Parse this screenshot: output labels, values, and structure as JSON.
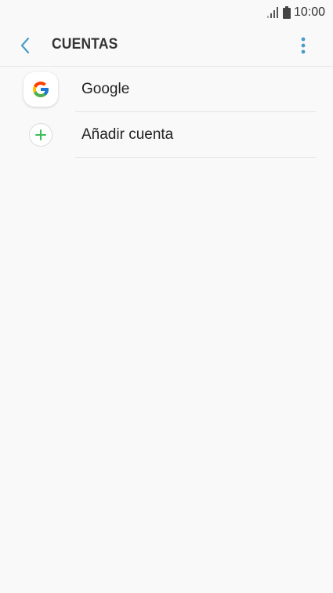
{
  "status_bar": {
    "time": "10:00",
    "signal_icon": "signal-icon",
    "battery_icon": "battery-icon"
  },
  "app_bar": {
    "title": "CUENTAS",
    "back_icon": "back-arrow-icon",
    "more_icon": "more-vert-icon",
    "accent_color": "#4a9cc9"
  },
  "accounts": {
    "items": [
      {
        "label": "Google",
        "icon": "google-icon"
      },
      {
        "label": "Añadir cuenta",
        "icon": "add-icon",
        "icon_color": "#3ebd56"
      }
    ]
  }
}
